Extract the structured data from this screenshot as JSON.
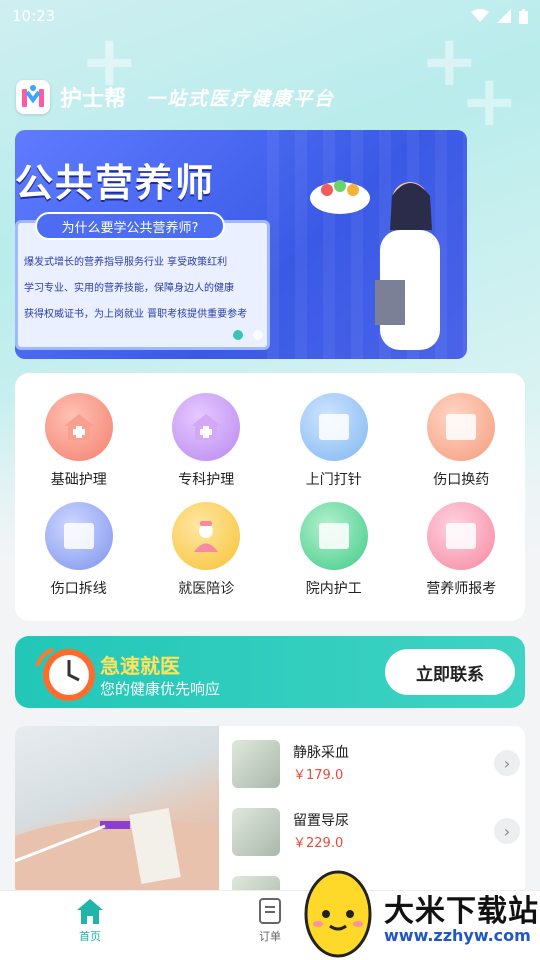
{
  "status_bar": {
    "time": "10:23"
  },
  "app": {
    "name": "护士帮",
    "slogan": "一站式医疗健康平台"
  },
  "banner": {
    "title": "公共营养师",
    "question": "为什么要学公共营养师?",
    "lines": [
      "爆发式增长的营养指导服务行业 享受政策红利",
      "学习专业、实用的营养技能，保障身边人的健康",
      "获得权威证书，为上岗就业 晋职考核提供重要参考"
    ]
  },
  "services": [
    {
      "label": "基础护理",
      "icon": "hospital-house-icon",
      "color": "red"
    },
    {
      "label": "专科护理",
      "icon": "hospital-house-icon",
      "color": "purple"
    },
    {
      "label": "上门打针",
      "icon": "injection-photo-icon",
      "color": "blue"
    },
    {
      "label": "伤口换药",
      "icon": "bandage-photo-icon",
      "color": "orange"
    },
    {
      "label": "伤口拆线",
      "icon": "stitches-photo-icon",
      "color": "indigo"
    },
    {
      "label": "就医陪诊",
      "icon": "nurse-icon",
      "color": "yellow"
    },
    {
      "label": "院内护工",
      "icon": "caregiver-photo-icon",
      "color": "green"
    },
    {
      "label": "营养师报考",
      "icon": "certificate-photo-icon",
      "color": "pink"
    }
  ],
  "urgent": {
    "title": "急速就医",
    "subtitle": "您的健康优先响应",
    "button": "立即联系"
  },
  "products": [
    {
      "name": "静脉采血",
      "price": "￥179.0"
    },
    {
      "name": "留置导尿",
      "price": "￥229.0"
    }
  ],
  "tabs": [
    {
      "label": "首页",
      "active": true
    },
    {
      "label": "订单",
      "active": false
    }
  ],
  "watermark": {
    "text1": "大米下载站",
    "text2": "www.zzhyw.com"
  },
  "colors": {
    "accent": "#22c7b8",
    "price": "#e84a3a",
    "urgent_title": "#ffe35a",
    "tab_active": "#1fb5a9"
  }
}
